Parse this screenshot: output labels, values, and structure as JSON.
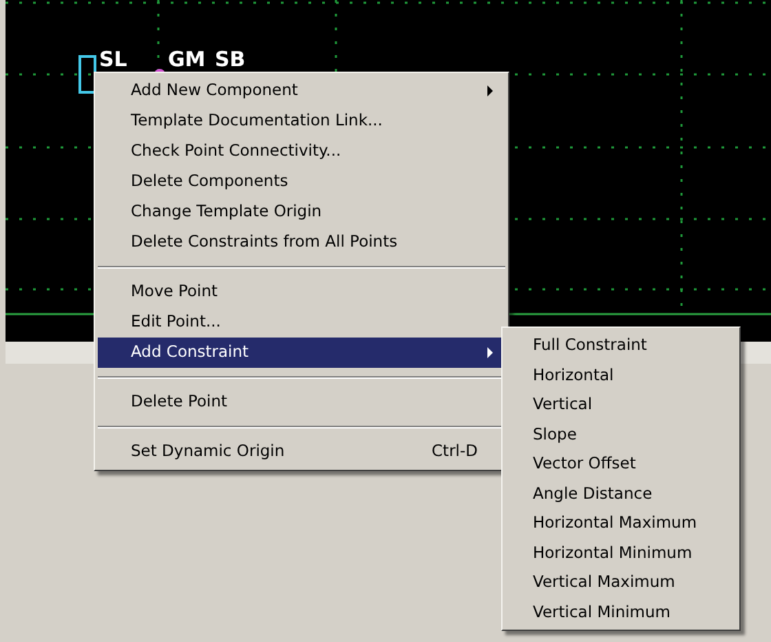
{
  "canvas": {
    "labels": [
      "SL",
      "GM",
      "SB"
    ]
  },
  "context_menu": {
    "items": [
      {
        "kind": "item",
        "label": "Add New Component",
        "has_submenu": true,
        "selected": false
      },
      {
        "kind": "item",
        "label": "Template Documentation Link...",
        "has_submenu": false,
        "selected": false
      },
      {
        "kind": "item",
        "label": "Check Point Connectivity...",
        "has_submenu": false,
        "selected": false
      },
      {
        "kind": "item",
        "label": "Delete Components",
        "has_submenu": false,
        "selected": false
      },
      {
        "kind": "item",
        "label": "Change Template Origin",
        "has_submenu": false,
        "selected": false
      },
      {
        "kind": "item",
        "label": "Delete Constraints from All Points",
        "has_submenu": false,
        "selected": false
      },
      {
        "kind": "separator"
      },
      {
        "kind": "item",
        "label": "Move Point",
        "has_submenu": false,
        "selected": false
      },
      {
        "kind": "item",
        "label": "Edit Point...",
        "has_submenu": false,
        "selected": false
      },
      {
        "kind": "item",
        "label": "Add Constraint",
        "has_submenu": true,
        "selected": true
      },
      {
        "kind": "separator"
      },
      {
        "kind": "item",
        "label": "Delete Point",
        "has_submenu": false,
        "selected": false
      },
      {
        "kind": "separator"
      },
      {
        "kind": "item",
        "label": "Set Dynamic Origin",
        "shortcut": "Ctrl-D",
        "has_submenu": false,
        "selected": false
      }
    ]
  },
  "submenu": {
    "items": [
      "Full Constraint",
      "Horizontal",
      "Vertical",
      "Slope",
      "Vector Offset",
      "Angle Distance",
      "Horizontal Maximum",
      "Horizontal Minimum",
      "Vertical Maximum",
      "Vertical Minimum"
    ]
  }
}
